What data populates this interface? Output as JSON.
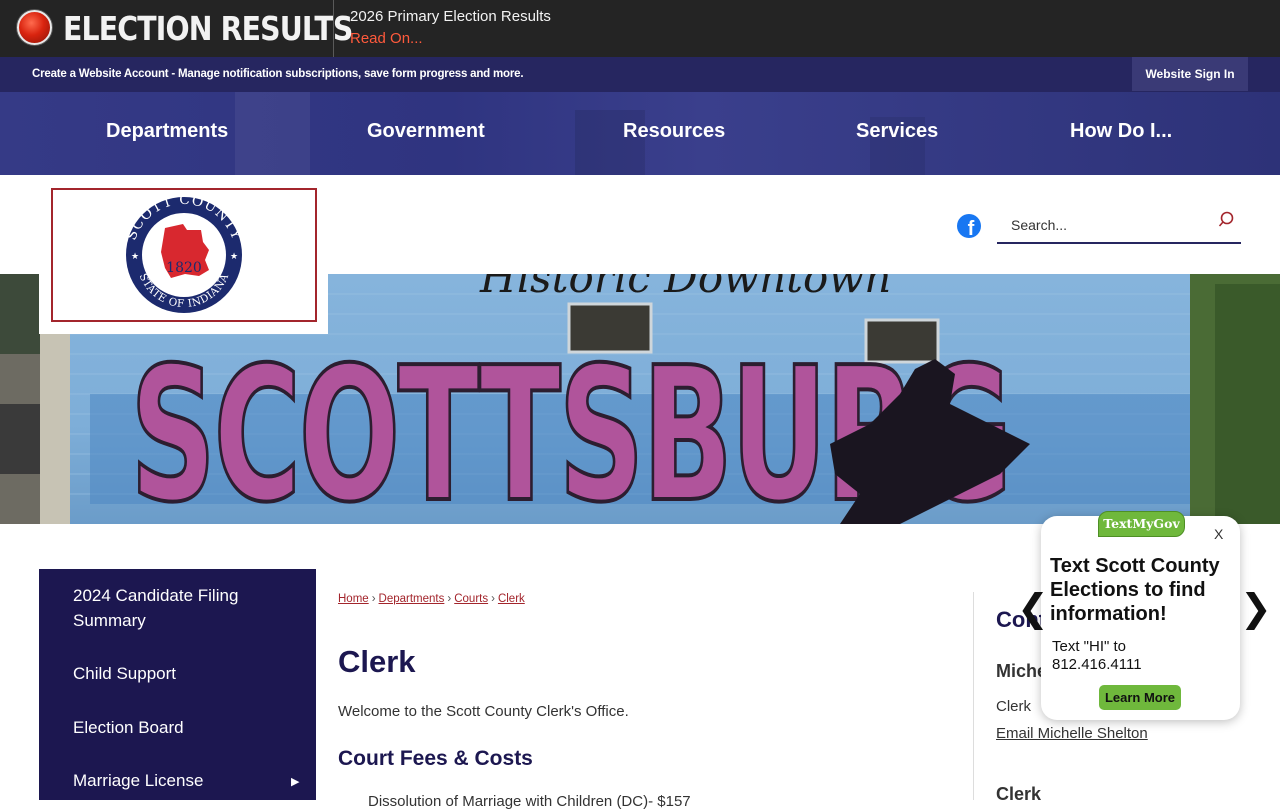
{
  "alert": {
    "title": "ELECTION RESULTS",
    "headline": "2026 Primary Election Results",
    "read_more": "Read On..."
  },
  "account_bar": {
    "message": "Create a Website Account - Manage notification subscriptions, save form progress and more.",
    "sign_in": "Website Sign In"
  },
  "nav": {
    "items": [
      "Departments",
      "Government",
      "Resources",
      "Services",
      "How Do I..."
    ]
  },
  "logo": {
    "text_top": "SCOTT COUNTY",
    "text_bottom": "STATE OF INDIANA",
    "year": "1820"
  },
  "header": {
    "social_icon": "facebook-icon",
    "search_placeholder": "Search...",
    "search_icon": "search-icon"
  },
  "banner": {
    "mural_text": "SCOTTSBURG",
    "script_text": "Historic Downtown"
  },
  "sidebar": {
    "items": [
      {
        "label": "2024 Candidate Filing Summary"
      },
      {
        "label": "Child Support"
      },
      {
        "label": "Election Board"
      },
      {
        "label": "Marriage License"
      }
    ],
    "expand_icon": "triangle-right-icon"
  },
  "breadcrumb": {
    "items": [
      "Home",
      "Departments",
      "Courts",
      "Clerk"
    ],
    "separator": "›"
  },
  "main": {
    "title": "Clerk",
    "welcome": "Welcome to the Scott County Clerk's Office.",
    "fees_heading": "Court Fees & Costs",
    "fee_item": "Dissolution of Marriage with Children (DC)- $157"
  },
  "contact": {
    "heading": "Cont",
    "name": "Miche",
    "role": "Clerk",
    "email": "Email Michelle Shelton",
    "second_heading": "Clerk"
  },
  "popup": {
    "brand": "TextMyGov",
    "close": "X",
    "title": "Text Scott County Elections to find information!",
    "body": "Text \"HI\" to 812.416.4111",
    "button": "Learn More",
    "prev": "❮",
    "next": "❯"
  },
  "colors": {
    "alert_bg": "#242424",
    "accent_red": "#ff5a3c",
    "navy": "#262660",
    "sidebar_bg": "#1c1750",
    "crumb_link": "#a3252c",
    "popup_green": "#6fb83c"
  }
}
